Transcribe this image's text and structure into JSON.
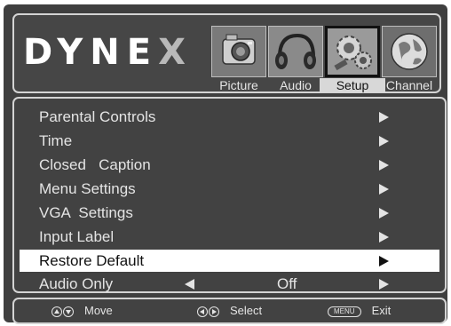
{
  "brand": {
    "logo_left": "DYNE",
    "logo_x": "X"
  },
  "tabs": [
    {
      "label": "Picture",
      "icon": "camera-icon"
    },
    {
      "label": "Audio",
      "icon": "headphones-icon"
    },
    {
      "label": "Setup",
      "icon": "gears-icon",
      "active": true
    },
    {
      "label": "Channel",
      "icon": "globe-icon"
    }
  ],
  "menu": {
    "items": [
      {
        "label": "Parental Controls"
      },
      {
        "label": "Time"
      },
      {
        "label": "Closed   Caption"
      },
      {
        "label": "Menu Settings"
      },
      {
        "label": "VGA  Settings"
      },
      {
        "label": "Input Label"
      },
      {
        "label": "Restore Default",
        "selected": true
      },
      {
        "label": "Audio Only",
        "value": "Off"
      }
    ]
  },
  "footer": {
    "move_label": "Move",
    "select_label": "Select",
    "menu_key": "MENU",
    "exit_label": "Exit"
  },
  "colors": {
    "background": "#3f3f3f",
    "border": "#d4d4d4",
    "selected": "#ffffff"
  }
}
